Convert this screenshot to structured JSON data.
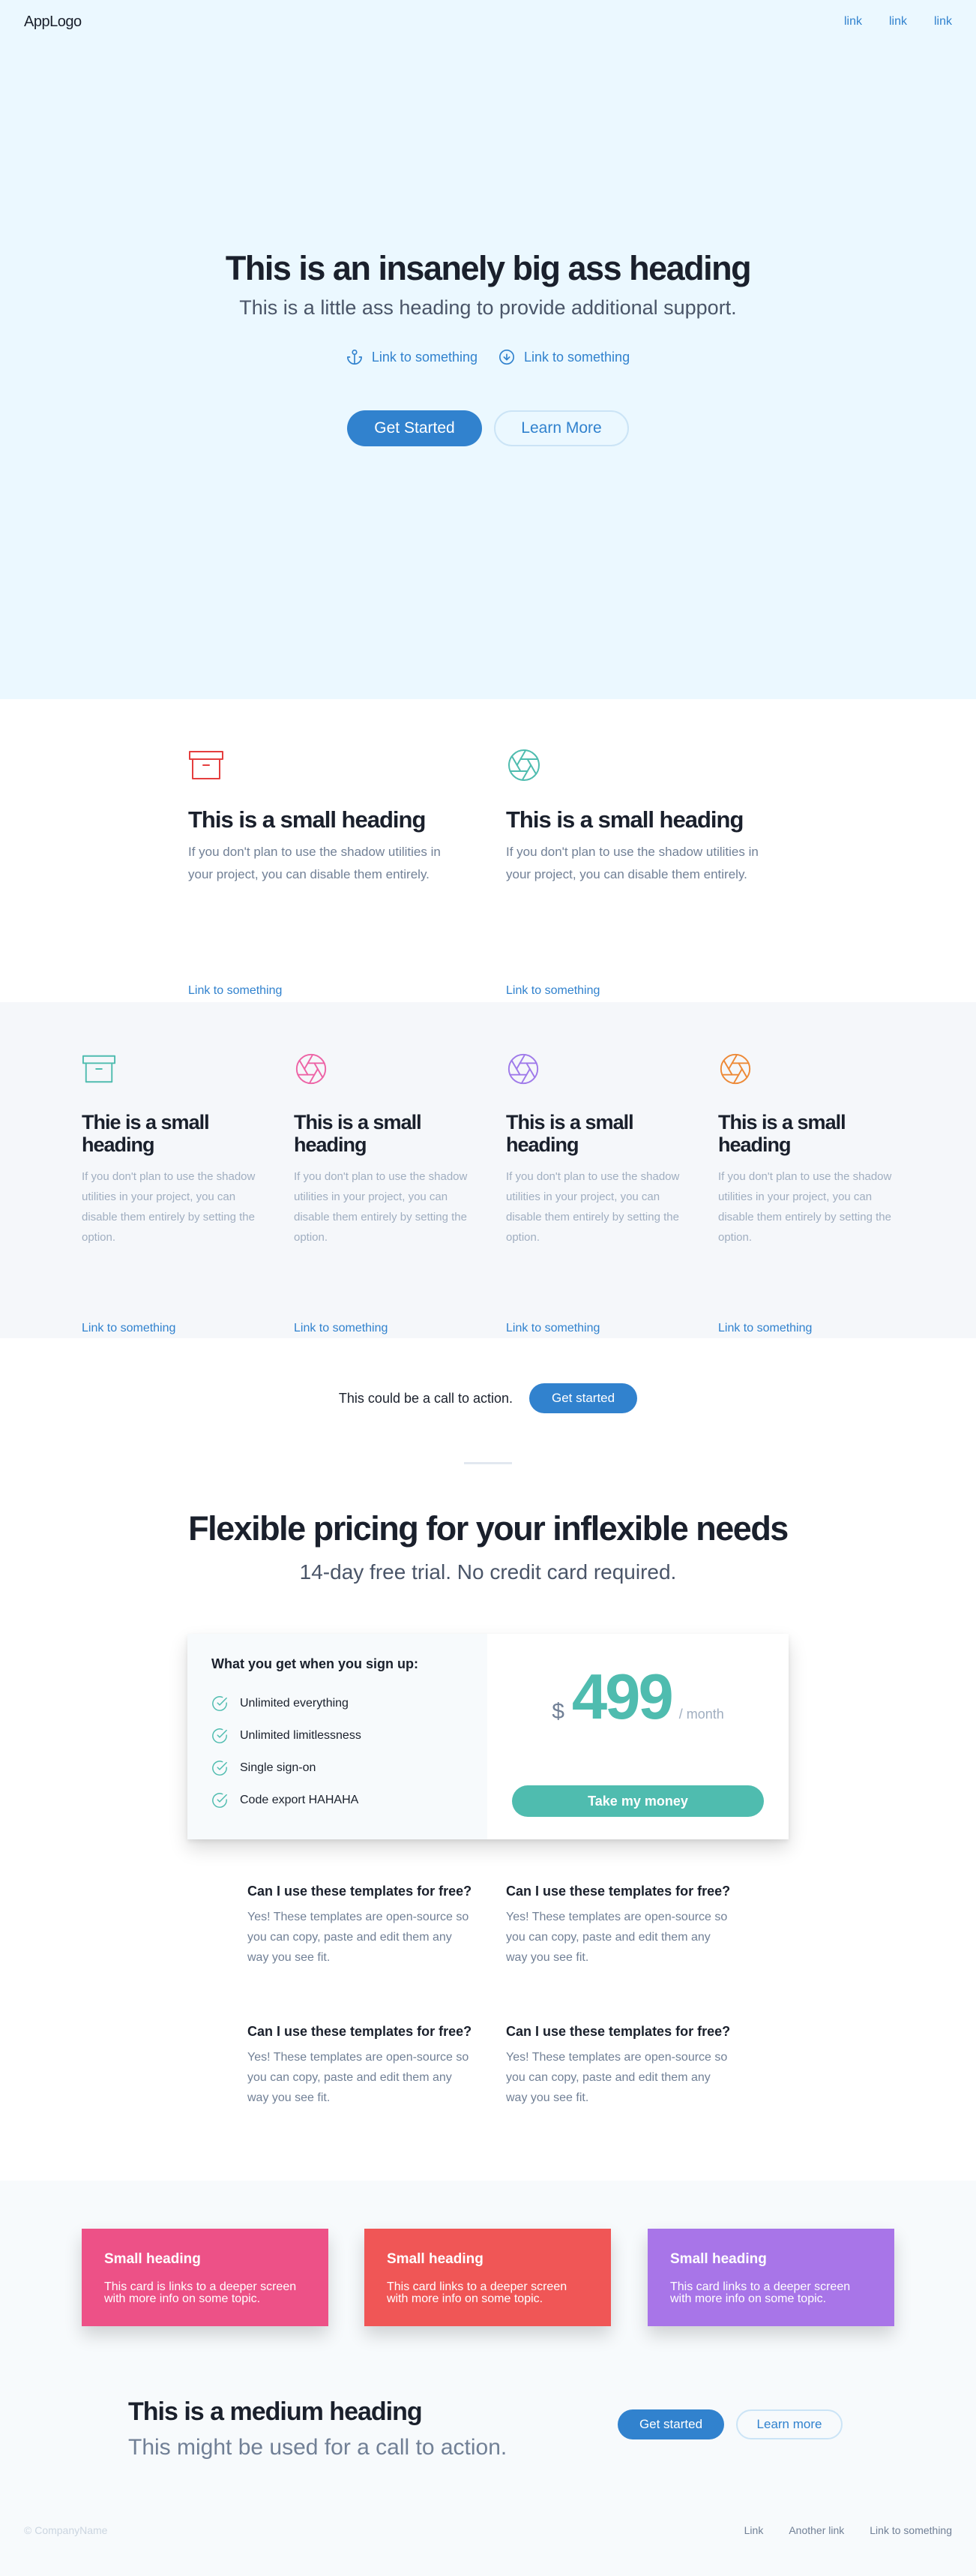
{
  "nav": {
    "logo": "AppLogo",
    "links": [
      "link",
      "link",
      "link"
    ]
  },
  "hero": {
    "title": "This is an insanely big ass heading",
    "subtitle": "This is a little ass heading to provide additional support.",
    "links": [
      "Link to something",
      "Link to something"
    ],
    "primary_button": "Get Started",
    "secondary_button": "Learn More"
  },
  "features_two": [
    {
      "icon": "archive-icon",
      "color": "#e53e3e",
      "title": "This is a small heading",
      "text": "If you don't plan to use the shadow utilities in your project, you can disable them entirely.",
      "link": "Link to something"
    },
    {
      "icon": "aperture-icon",
      "color": "#4fbcaf",
      "title": "This is a small heading",
      "text": "If you don't plan to use the shadow utilities in your project, you can disable them entirely.",
      "link": "Link to something"
    }
  ],
  "features_four": [
    {
      "icon": "archive-icon",
      "color": "#4fbcaf",
      "title": "Thie is a small heading",
      "text": "If you don't plan to use the shadow utilities in your project, you can disable them entirely by setting the option.",
      "link": "Link to something"
    },
    {
      "icon": "aperture-icon",
      "color": "#ed64a6",
      "title": "This is a small heading",
      "text": "If you don't plan to use the shadow utilities in your project, you can disable them entirely by setting the option.",
      "link": "Link to something"
    },
    {
      "icon": "aperture-icon",
      "color": "#9f7aea",
      "title": "This is a small heading",
      "text": "If you don't plan to use the shadow utilities in your project, you can disable them entirely by setting the option.",
      "link": "Link to something"
    },
    {
      "icon": "aperture-icon",
      "color": "#ed8936",
      "title": "This is a small heading",
      "text": "If you don't plan to use the shadow utilities in your project, you can disable them entirely by setting the option.",
      "link": "Link to something"
    }
  ],
  "cta": {
    "text": "This could be a call to action.",
    "button": "Get started"
  },
  "pricing": {
    "title": "Flexible pricing for your inflexible needs",
    "subtitle": "14-day free trial. No credit card required.",
    "includes_heading": "What you get when you sign up:",
    "features": [
      "Unlimited everything",
      "Unlimited limitlessness",
      "Single sign-on",
      "Code export HAHAHA"
    ],
    "currency": "$",
    "price": "499",
    "period": "/ month",
    "button": "Take my money",
    "accent": "#4fbcaf"
  },
  "faq": [
    {
      "q": "Can I use these templates for free?",
      "a": "Yes! These templates are open-source so you can copy, paste and edit them any way you see fit."
    },
    {
      "q": "Can I use these templates for free?",
      "a": "Yes! These templates are open-source so you can copy, paste and edit them any way you see fit."
    },
    {
      "q": "Can I use these templates for free?",
      "a": "Yes! These templates are open-source so you can copy, paste and edit them any way you see fit."
    },
    {
      "q": "Can I use these templates for free?",
      "a": "Yes! These templates are open-source so you can copy, paste and edit them any way you see fit."
    }
  ],
  "cards": [
    {
      "title": "Small heading",
      "text": "This card is links to a deeper screen with more info on some topic.",
      "color": "#ed5187"
    },
    {
      "title": "Small heading",
      "text": "This card links to a deeper screen with more info on some topic.",
      "color": "#f05656"
    },
    {
      "title": "Small heading",
      "text": "This card links to a deeper screen with more info on some topic.",
      "color": "#a875e8"
    }
  ],
  "medium": {
    "title": "This is a medium heading",
    "subtitle": "This might be used for a call to action.",
    "primary_button": "Get started",
    "secondary_button": "Learn more"
  },
  "footer": {
    "copyright": "© CompanyName",
    "links": [
      "Link",
      "Another link",
      "Link to something"
    ]
  }
}
